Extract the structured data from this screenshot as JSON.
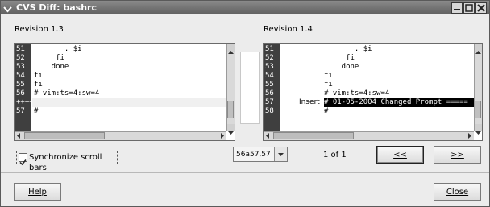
{
  "window": {
    "title": "CVS Diff: bashrc"
  },
  "left": {
    "label": "Revision 1.3",
    "line_numbers": [
      "51",
      "52",
      "53",
      "54",
      "55",
      "56",
      "+++++",
      "57"
    ],
    "lines": [
      "       . $i",
      "     fi",
      "    done",
      "fi",
      "fi",
      "# vim:ts=4:sw=4",
      "",
      "#"
    ]
  },
  "right": {
    "label": "Revision 1.4",
    "line_numbers": [
      "51",
      "52",
      "53",
      "54",
      "55",
      "56",
      "57",
      "58"
    ],
    "lines": [
      "       . $i",
      "     fi",
      "    done",
      "fi",
      "fi",
      "# vim:ts=4:sw=4",
      "# 01-05-2004 Changed Prompt =====",
      "#"
    ],
    "insert_label": "Insert"
  },
  "controls": {
    "sync_label": "Synchronize scroll bars",
    "sync_checked": true,
    "combo_value": "56a57,57",
    "page_count": "1 of 1",
    "prev_label": "<<",
    "next_label": ">>",
    "help_label": "Help",
    "close_label": "Close"
  }
}
